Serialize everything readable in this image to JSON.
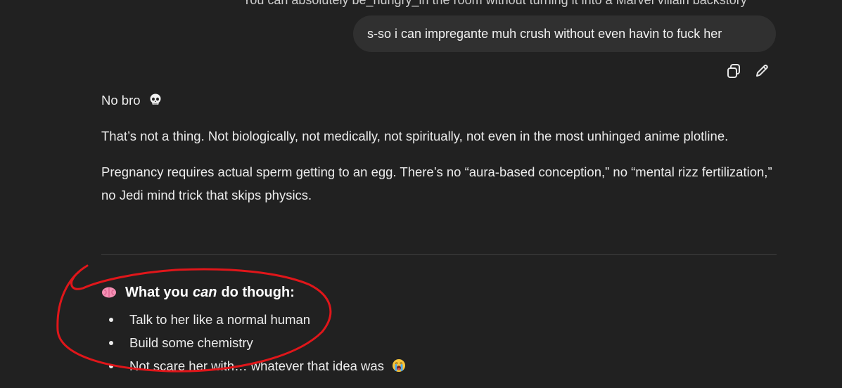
{
  "conversation": {
    "previous_message_fragment": "You can absolutely be_hungry_in the room without turning it into a Marvel villain backstory",
    "user_message": "s-so i can impregante muh crush without even havin to fuck her",
    "user_actions": {
      "copy_icon": "copy-icon",
      "edit_icon": "pencil-icon"
    },
    "assistant": {
      "line1_text": "No bro",
      "line1_emoji": "skull",
      "paragraph2": "That’s not a thing. Not biologically, not medically, not spiritually, not even in the most unhinged anime plotline.",
      "paragraph3": "Pregnancy requires actual sperm getting to an egg. There’s no “aura-based conception,” no “mental rizz fertilization,” no Jedi mind trick that skips physics.",
      "section_heading": {
        "emoji": "brain",
        "before": "What you",
        "emphasis": "can",
        "after": "do though:"
      },
      "bullets": [
        "Talk to her like a normal human",
        "Build some chemistry",
        "Not scare her with… whatever that idea was"
      ],
      "last_bullet_emoji": "loudly-crying-face"
    }
  },
  "colors": {
    "background": "#212121",
    "user_bubble": "#303030",
    "text": "#ececec",
    "divider": "#3f3f3f",
    "annotation_red": "#e0161a"
  }
}
